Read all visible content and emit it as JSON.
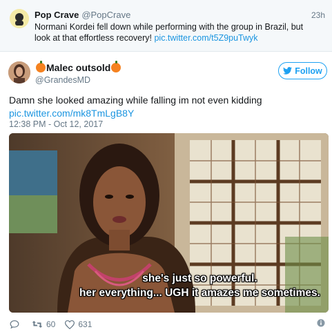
{
  "parent_tweet": {
    "name": "Pop Crave",
    "handle": "@PopCrave",
    "time": "23h",
    "text": "Normani Kordei fell down while performing with the group in Brazil, but look at that effortless recovery!",
    "link": "pic.twitter.com/t5Z9puTwyk"
  },
  "main_tweet": {
    "name": "Malec outsold",
    "handle": "@GrandesMD",
    "follow_label": "Follow",
    "text": "Damn she looked amazing while falling im not even kidding",
    "link": "pic.twitter.com/mk8TmLgB8Y",
    "timestamp": "12:38 PM - Oct 12, 2017",
    "media_caption_line1": "she's just so powerful.",
    "media_caption_line2": "her everything... UGH it amazes me sometimes."
  },
  "actions": {
    "retweets": "60",
    "likes": "631"
  },
  "colors": {
    "link": "#1b95e0",
    "follow": "#1da1f2",
    "muted": "#657786"
  }
}
